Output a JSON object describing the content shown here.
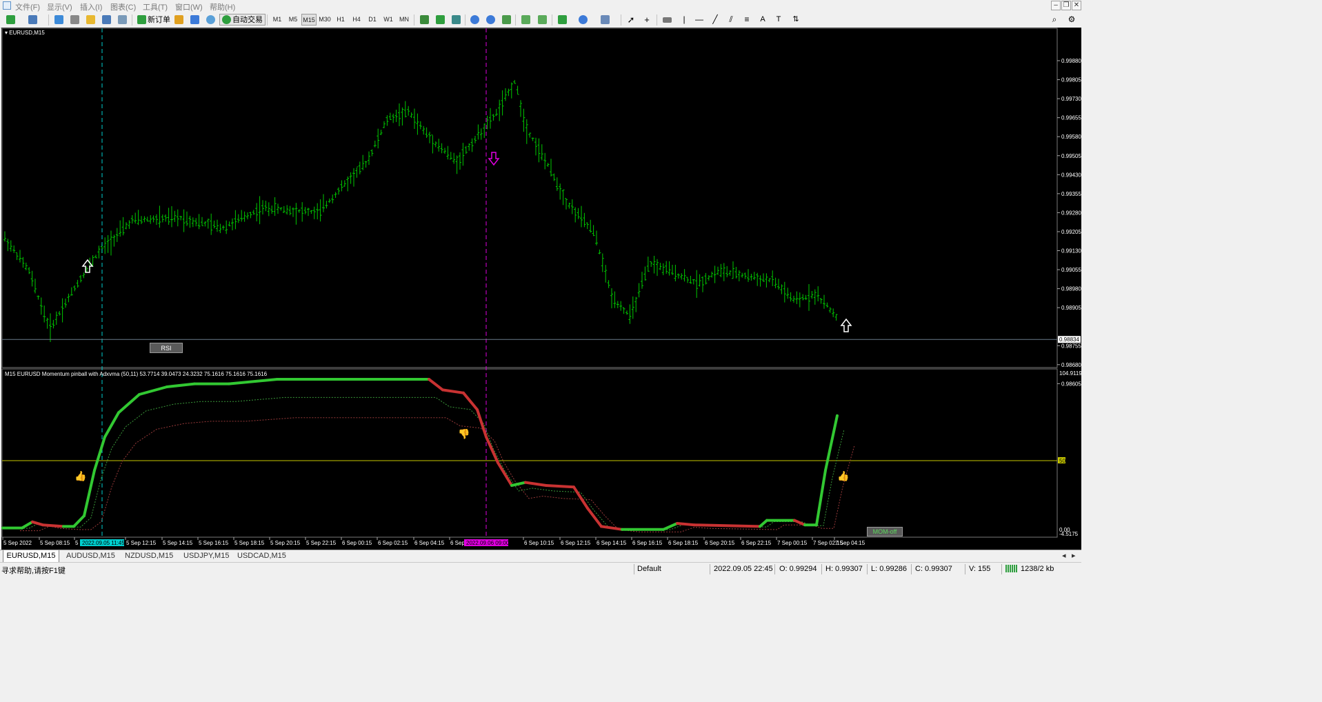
{
  "menu": {
    "items": [
      "文件(F)",
      "显示(V)",
      "插入(I)",
      "图表(C)",
      "工具(T)",
      "窗口(W)",
      "帮助(H)"
    ]
  },
  "toolbar": {
    "new_order": "新订单",
    "auto_trading": "自动交易",
    "timeframes": [
      "M1",
      "M5",
      "M15",
      "M30",
      "H1",
      "H4",
      "D1",
      "W1",
      "MN"
    ],
    "active_timeframe": "M15"
  },
  "chart": {
    "symbol_label": "EURUSD,M15",
    "price_scale": [
      "0.99880",
      "0.99805",
      "0.99730",
      "0.99655",
      "0.99580",
      "0.99505",
      "0.99430",
      "0.99355",
      "0.99280",
      "0.99205",
      "0.99130",
      "0.99055",
      "0.98980",
      "0.98905",
      "0.98755",
      "0.98680",
      "0.98605"
    ],
    "current_price": "0.98834",
    "rsi_button": "RSI",
    "indicator_label": "M15 EURUSD Momentum pinball with Adxvma (50,11) 53.7714 39.0473 24.3232 75.1616 75.1616 75.1616",
    "indicator_scale_top": "104.9119",
    "indicator_level": "50",
    "indicator_scale_bottom": "0.00",
    "indicator_scale_min": "-4.5175",
    "mom_button": "MOM-off",
    "time_axis": [
      "5 Sep 2022",
      "5 Sep 08:15",
      "5",
      "5 Sep 12:15",
      "5 Sep 14:15",
      "5 Sep 16:15",
      "5 Sep 18:15",
      "5 Sep 20:15",
      "5 Sep 22:15",
      "6 Sep 00:15",
      "6 Sep 02:15",
      "6 Sep 04:15",
      "6 Sep 06:15",
      "6 Sep 10:15",
      "6 Sep 12:15",
      "6 Sep 14:15",
      "6 Sep 16:15",
      "6 Sep 18:15",
      "6 Sep 20:15",
      "6 Sep 22:15",
      "7 Sep 00:15",
      "7 Sep 02:15",
      "7 Sep 04:15"
    ],
    "cursor_time_1": "2022.09.05 11:45",
    "cursor_time_2": "2022.09.06 09:00",
    "colors": {
      "candle": "#00c800",
      "momentum_up": "#32c832",
      "momentum_down": "#c83232",
      "cursor_1": "#00d0d0",
      "cursor_2": "#e000e0",
      "level_line": "#c8c800",
      "bid_line": "#6a7a8a"
    }
  },
  "tabs": [
    "EURUSD,M15",
    "AUDUSD,M15",
    "NZDUSD,M15",
    "USDJPY,M15",
    "USDCAD,M15"
  ],
  "status": {
    "help": "寻求帮助,请按F1键",
    "profile": "Default",
    "datetime": "2022.09.05 22:45",
    "open": "O: 0.99294",
    "high": "H: 0.99307",
    "low": "L: 0.99286",
    "close": "C: 0.99307",
    "volume": "V: 155",
    "traffic": "1238/2 kb"
  }
}
